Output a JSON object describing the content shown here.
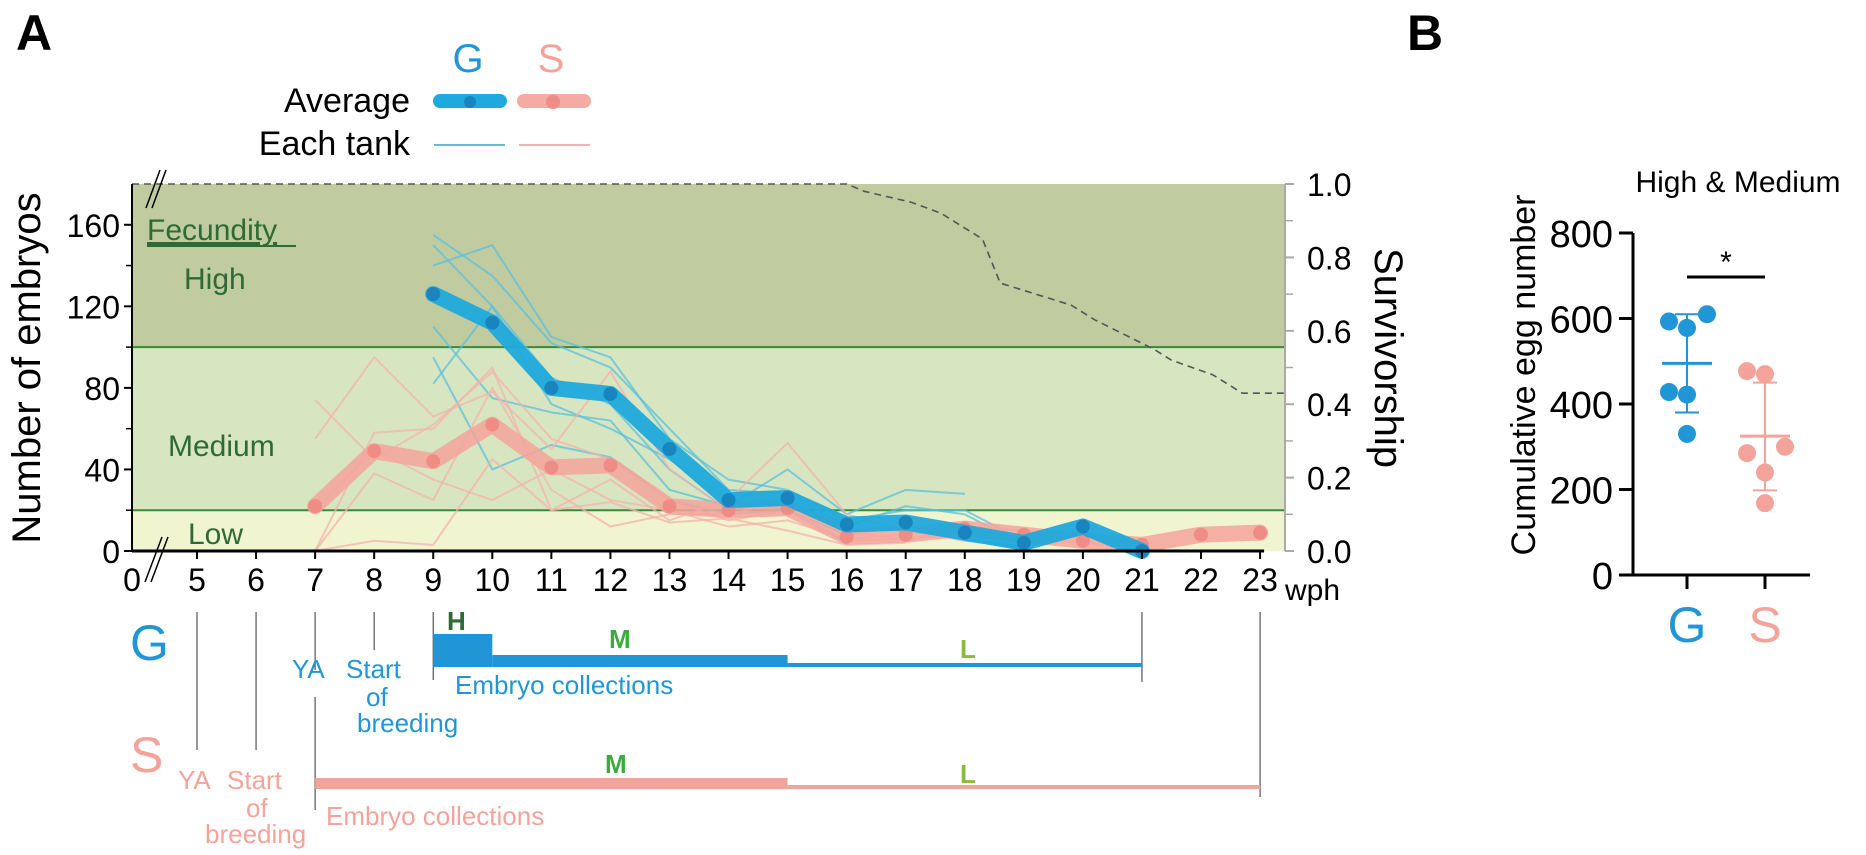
{
  "chart_data": [
    {
      "panel": "A",
      "type": "line",
      "legend": {
        "groups": [
          "G",
          "S"
        ],
        "rows": [
          "Average",
          "Each tank"
        ],
        "placement": "top-center"
      },
      "xlabel": "wph",
      "x_ticks": [
        "0",
        "5",
        "6",
        "7",
        "8",
        "9",
        "10",
        "11",
        "12",
        "13",
        "14",
        "15",
        "16",
        "17",
        "18",
        "19",
        "20",
        "21",
        "22",
        "23"
      ],
      "x_range": [
        4,
        23
      ],
      "ylabel_left": "Number of embryos",
      "y_ticks_left": [
        "0",
        "40",
        "80",
        "120",
        "160"
      ],
      "ylim_left": [
        0,
        180
      ],
      "ylabel_right": "Survivorship",
      "y_ticks_right": [
        "0.0",
        "0.2",
        "0.4",
        "0.6",
        "0.8",
        "1.0"
      ],
      "ylim_right": [
        0,
        1.0
      ],
      "zones": [
        {
          "name": "High",
          "from": 100,
          "to": 180,
          "color": "#c0cb9f"
        },
        {
          "name": "Medium",
          "from": 20,
          "to": 100,
          "color": "#d7e6c0"
        },
        {
          "name": "Low",
          "from": 0,
          "to": 20,
          "color": "#f0f4cf"
        }
      ],
      "zone_heading": "Fecundity",
      "series": [
        {
          "name": "G Average",
          "color": "#1fa9dc",
          "x": [
            9,
            10,
            11,
            12,
            13,
            14,
            15,
            16,
            17,
            18,
            19,
            20,
            21
          ],
          "values": [
            126,
            112,
            80,
            77,
            50,
            25,
            26,
            13,
            14,
            9,
            4,
            12,
            0
          ]
        },
        {
          "name": "S Average",
          "color": "#f4a39b",
          "x": [
            7,
            8,
            9,
            10,
            11,
            12,
            13,
            14,
            15,
            16,
            17,
            18,
            19,
            20,
            21,
            22,
            23
          ],
          "values": [
            22,
            49,
            44,
            62,
            41,
            42,
            22,
            20,
            21,
            7,
            8,
            11,
            8,
            5,
            3,
            8,
            9
          ]
        },
        {
          "name": "G tanks",
          "color": "#5bc0de",
          "tanks": [
            {
              "x": [
                9,
                10,
                11,
                12,
                13,
                14,
                15,
                16,
                17,
                18,
                19
              ],
              "values": [
                155,
                135,
                102,
                90,
                60,
                30,
                28,
                12,
                22,
                18,
                3
              ]
            },
            {
              "x": [
                9,
                10,
                11,
                12,
                13,
                14,
                15,
                16,
                17,
                18,
                19
              ],
              "values": [
                150,
                120,
                85,
                72,
                40,
                20,
                25,
                10,
                10,
                6,
                2
              ]
            },
            {
              "x": [
                9,
                10,
                11,
                12,
                13,
                14,
                15,
                16,
                17,
                18,
                19,
                20,
                21
              ],
              "values": [
                140,
                150,
                105,
                95,
                55,
                35,
                30,
                15,
                20,
                20,
                5,
                10,
                0
              ]
            },
            {
              "x": [
                9,
                10,
                11,
                12,
                13,
                14,
                15,
                16,
                17,
                18
              ],
              "values": [
                110,
                75,
                68,
                64,
                30,
                22,
                40,
                18,
                30,
                28
              ]
            },
            {
              "x": [
                9,
                10,
                11,
                12,
                13,
                14,
                15,
                16,
                17,
                18,
                19
              ],
              "values": [
                82,
                120,
                72,
                60,
                45,
                25,
                20,
                8,
                12,
                5,
                2
              ]
            },
            {
              "x": [
                9,
                10,
                11,
                12,
                13,
                14,
                15,
                16
              ],
              "values": [
                95,
                40,
                52,
                46,
                25,
                18,
                20,
                4
              ]
            }
          ]
        },
        {
          "name": "S tanks",
          "color": "#f4b3ad",
          "tanks": [
            {
              "x": [
                7,
                8,
                9,
                10,
                11,
                12,
                13,
                14,
                15,
                16,
                17,
                18,
                19,
                20,
                21
              ],
              "values": [
                74,
                45,
                62,
                88,
                55,
                45,
                25,
                15,
                20,
                5,
                6,
                8,
                6,
                4,
                2
              ]
            },
            {
              "x": [
                7,
                8,
                9,
                10,
                11,
                12,
                13,
                14,
                15,
                16,
                17,
                18,
                19
              ],
              "values": [
                55,
                95,
                66,
                78,
                50,
                88,
                40,
                20,
                30,
                10,
                12,
                10,
                5
              ]
            },
            {
              "x": [
                7,
                8,
                9,
                10,
                11,
                12,
                13,
                14,
                15,
                16,
                17,
                18
              ],
              "values": [
                0,
                58,
                60,
                90,
                20,
                35,
                15,
                25,
                53,
                18,
                10,
                5
              ]
            },
            {
              "x": [
                7,
                8,
                9,
                10,
                11,
                12,
                13,
                14,
                15,
                16,
                17,
                18,
                19,
                20
              ],
              "values": [
                0,
                38,
                25,
                80,
                30,
                12,
                18,
                18,
                25,
                10,
                5,
                12,
                10,
                6
              ]
            },
            {
              "x": [
                7,
                8,
                9,
                10,
                11,
                12,
                13,
                14,
                15,
                16,
                17
              ],
              "values": [
                0,
                5,
                3,
                45,
                20,
                24,
                14,
                16,
                10,
                3,
                4
              ]
            },
            {
              "x": [
                7,
                8,
                9,
                10,
                11,
                12,
                13,
                14,
                15,
                16,
                17
              ],
              "values": [
                20,
                50,
                35,
                25,
                40,
                25,
                20,
                12,
                15,
                6,
                8
              ]
            }
          ]
        },
        {
          "name": "Survivorship",
          "axis": "right",
          "style": "dashed-step",
          "color": "#555555",
          "x": [
            0,
            16.0,
            16.3,
            17.1,
            17.6,
            18.3,
            18.6,
            19.2,
            19.8,
            20.2,
            20.7,
            21.2,
            21.5,
            22.2,
            22.7,
            23.4
          ],
          "values": [
            1.0,
            1.0,
            0.98,
            0.95,
            0.92,
            0.85,
            0.73,
            0.7,
            0.67,
            0.63,
            0.59,
            0.55,
            0.52,
            0.48,
            0.43,
            0.43
          ]
        }
      ]
    },
    {
      "panel": "B",
      "type": "scatter",
      "title": "High & Medium",
      "ylabel": "Cumulative egg number",
      "y_ticks": [
        "0",
        "200",
        "400",
        "600",
        "800"
      ],
      "ylim": [
        0,
        800
      ],
      "categories": [
        "G",
        "S"
      ],
      "series": [
        {
          "name": "G",
          "color": "#2196d6",
          "values": [
            593,
            578,
            610,
            428,
            422,
            330
          ],
          "mean": 495,
          "error": [
            380,
            610
          ]
        },
        {
          "name": "S",
          "color": "#f4a39b",
          "values": [
            477,
            470,
            300,
            285,
            240,
            168
          ],
          "mean": 325,
          "error": [
            198,
            450
          ]
        }
      ],
      "significance": "*"
    }
  ],
  "labels": {
    "panel_a": "A",
    "panel_b": "B",
    "legend_g": "G",
    "legend_s": "S",
    "legend_average": "Average",
    "legend_each_tank": "Each tank",
    "fecundity": "Fecundity",
    "high": "High",
    "medium": "Medium",
    "low": "Low",
    "ylabel_left": "Number of embryos",
    "ylabel_right": "Survivorship",
    "xunit": "wph",
    "b_title": "High & Medium",
    "b_ylabel": "Cumulative egg number",
    "b_sig": "*",
    "b_cat_g": "G",
    "b_cat_s": "S"
  },
  "timeline": {
    "g_label": "G",
    "s_label": "S",
    "ya": "YA",
    "start": "Start",
    "of": "of",
    "breeding": "breeding",
    "embryo_collections": "Embryo collections",
    "h": "H",
    "m": "M",
    "l": "L",
    "g_ya_wph": 5,
    "g_start_wph": 6,
    "g_collect_start": 9,
    "g_high_end": 10,
    "g_medium_end": 15,
    "g_collect_end": 21,
    "s_ya_wph": 5,
    "s_start_wph": 6,
    "s_collect_start": 7,
    "s_medium_end": 15,
    "s_collect_end": 23
  },
  "colors": {
    "g": "#2196d6",
    "g_line": "#1fa9dc",
    "s": "#f4a39b",
    "dark_green": "#2d6a35",
    "green": "#3daa3d",
    "light_green": "#8bba3d",
    "zone_line": "#3a8a3a"
  }
}
